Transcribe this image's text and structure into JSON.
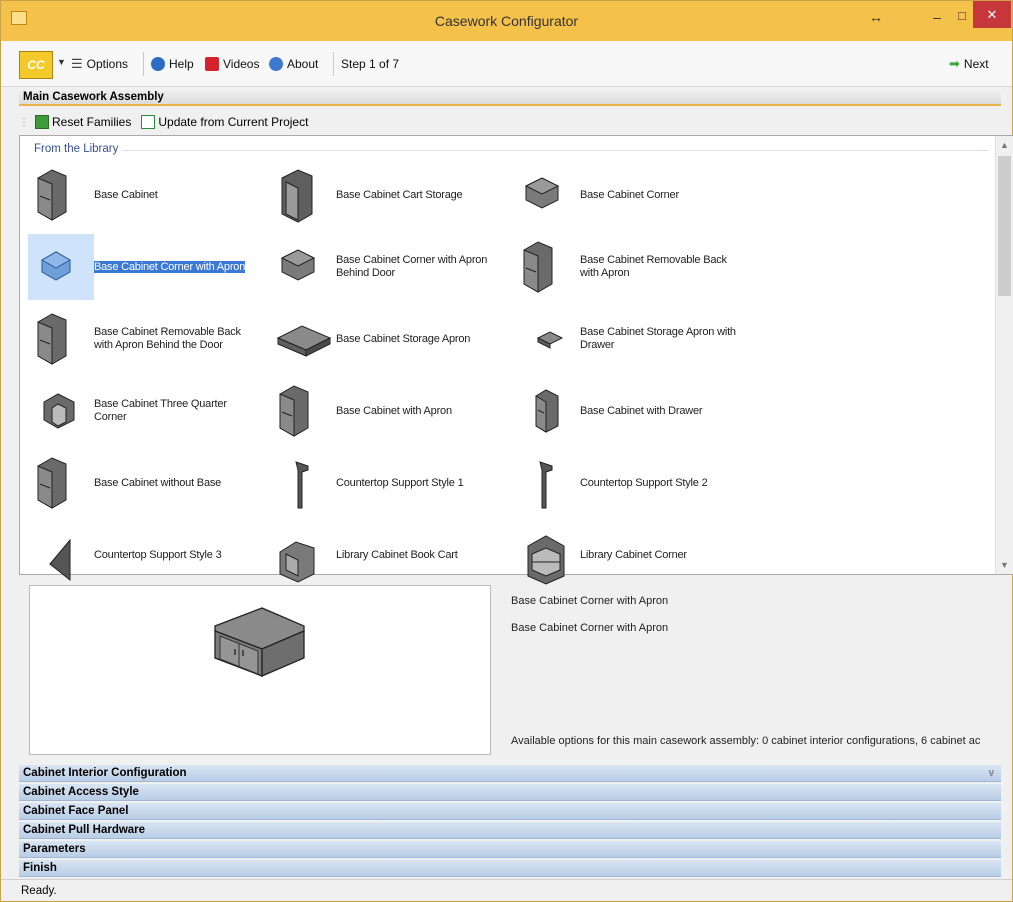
{
  "window": {
    "title": "Casework Configurator",
    "resize_glyph": "↔",
    "minimize_glyph": "–",
    "maximize_glyph": "□",
    "close_glyph": "✕"
  },
  "toolbar": {
    "logo_text": "CC",
    "dropdown_glyph": "▼",
    "options_label": "Options",
    "help_label": "Help",
    "videos_label": "Videos",
    "about_label": "About",
    "step_label": "Step 1 of 7",
    "next_label": "Next"
  },
  "main_section": {
    "header": "Main Casework Assembly",
    "reset_families_label": "Reset Families",
    "update_label": "Update from Current Project"
  },
  "library": {
    "legend": "From the Library",
    "items": [
      {
        "label": "Base Cabinet",
        "icon": "cabinet-icon"
      },
      {
        "label": "Base Cabinet Cart Storage",
        "icon": "cabinet-open-icon"
      },
      {
        "label": "Base Cabinet Corner",
        "icon": "corner-icon"
      },
      {
        "label": "Base Cabinet Corner with Apron",
        "icon": "corner-apron-icon",
        "selected": true
      },
      {
        "label": "Base Cabinet Corner with Apron Behind Door",
        "icon": "corner-icon"
      },
      {
        "label": "Base Cabinet Removable Back with Apron",
        "icon": "cabinet-icon"
      },
      {
        "label": "Base Cabinet Removable Back with Apron Behind the Door",
        "icon": "cabinet-icon"
      },
      {
        "label": "Base Cabinet Storage Apron",
        "icon": "tray-icon"
      },
      {
        "label": "Base Cabinet Storage Apron with Drawer",
        "icon": "small-tray-icon"
      },
      {
        "label": "Base Cabinet Three Quarter Corner",
        "icon": "three-quarter-icon"
      },
      {
        "label": "Base Cabinet with Apron",
        "icon": "cabinet-icon"
      },
      {
        "label": "Base Cabinet with Drawer",
        "icon": "drawer-cabinet-icon"
      },
      {
        "label": "Base Cabinet without Base",
        "icon": "cabinet-icon"
      },
      {
        "label": "Countertop Support Style 1",
        "icon": "support-icon"
      },
      {
        "label": "Countertop Support Style 2",
        "icon": "support-icon"
      },
      {
        "label": "Countertop Support Style 3",
        "icon": "triangle-support-icon"
      },
      {
        "label": "Library Cabinet Book Cart",
        "icon": "cart-icon"
      },
      {
        "label": "Library Cabinet Corner",
        "icon": "library-corner-icon"
      }
    ]
  },
  "preview": {
    "name": "Base Cabinet Corner with Apron",
    "description": "Base Cabinet Corner with Apron",
    "options_text": "Available options for this main casework assembly: 0 cabinet interior configurations, 6 cabinet ac"
  },
  "sections": [
    "Cabinet Interior Configuration",
    "Cabinet Access Style",
    "Cabinet Face Panel",
    "Cabinet Pull Hardware",
    "Parameters",
    "Finish"
  ],
  "status": "Ready.",
  "colors": {
    "title_bar": "#f4c24a",
    "close_button": "#c7363a",
    "selection": "#3a78d6",
    "section_header": "#c8d8ee"
  }
}
